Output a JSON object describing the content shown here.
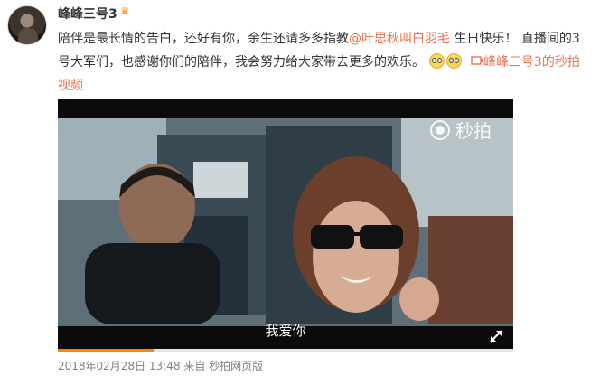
{
  "user": {
    "name": "峰峰三号3",
    "badge_icon": "crown-icon"
  },
  "post": {
    "text_part1": "陪伴是最长情的告白，还好有你，余生还请多多指教",
    "mention": "@叶思秋叫白羽毛",
    "text_part2": " 生日快乐！ 直播间的3号大军们，也感谢你们的陪伴，我会努力给大家带去更多的欢乐。",
    "emoji_names": [
      "onlooker-emoji",
      "onlooker-emoji"
    ],
    "link_text": "峰峰三号3的秒拍视频"
  },
  "video": {
    "watermark": "秒拍",
    "subtitle": "我爱你",
    "progress": 0.21
  },
  "meta": {
    "timestamp": "2018年02月28日 13:48",
    "source_prefix": "来自",
    "source": "秒拍网页版"
  },
  "colors": {
    "accent": "#eb7350",
    "progress": "#ff8200"
  }
}
